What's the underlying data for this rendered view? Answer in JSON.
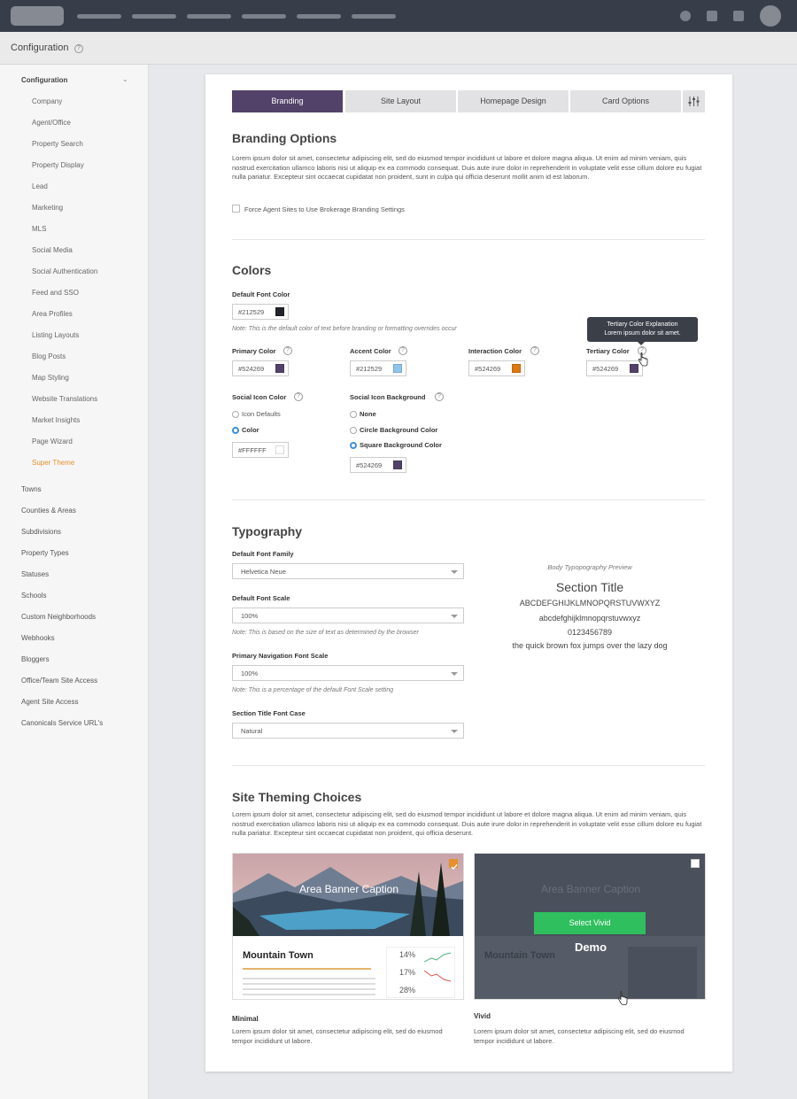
{
  "header": {
    "title": "Configuration"
  },
  "sidebar": {
    "section_title": "Configuration",
    "sub_items": [
      "Company",
      "Agent/Office",
      "Property Search",
      "Property Display",
      "Lead",
      "Marketing",
      "MLS",
      "Social Media",
      "Social Authentication",
      "Feed and SSO",
      "Area Profiles",
      "Listing Layouts",
      "Blog Posts",
      "Map Styling",
      "Website Translations",
      "Market Insights",
      "Page Wizard",
      "Super Theme"
    ],
    "active_sub_item": "Super Theme",
    "items": [
      "Towns",
      "Counties & Areas",
      "Subdivisions",
      "Property Types",
      "Statuses",
      "Schools",
      "Custom Neighborhoods",
      "Webhooks",
      "Bloggers",
      "Office/Team Site Access",
      "Agent Site Access",
      "Canonicals Service URL's"
    ]
  },
  "tabs": [
    "Branding",
    "Site Layout",
    "Homepage Design",
    "Card Options"
  ],
  "active_tab": "Branding",
  "branding": {
    "title": "Branding Options",
    "description": "Lorem ipsum dolor sit amet, consectetur adipiscing elit, sed do eiusmod tempor incididunt ut labore et dolore magna aliqua. Ut enim ad minim veniam, quis nostrud exercitation ullamco laboris nisi ut aliquip ex ea commodo consequat. Duis aute irure dolor in reprehenderit in voluptate velit esse cillum dolore eu fugiat nulla pariatur. Excepteur sint occaecat cupidatat non proident, sunt in culpa qui officia deserunt mollit anim id est laborum.",
    "checkbox_label": "Force Agent Sites to Use Brokerage Branding Settings",
    "checkbox_checked": false
  },
  "colors": {
    "title": "Colors",
    "default_font": {
      "label": "Default Font Color",
      "hex": "#212529",
      "swatch": "#212529"
    },
    "default_note": "Note: This is the default color of text before branding or formatting overrides occur",
    "primary": {
      "label": "Primary Color",
      "hex": "#524269",
      "swatch": "#524269"
    },
    "accent": {
      "label": "Accent Color",
      "hex": "#212529",
      "swatch": "#8ec5ec"
    },
    "interaction": {
      "label": "Interaction Color",
      "hex": "#524269",
      "swatch": "#e0780f"
    },
    "tertiary": {
      "label": "Tertiary Color",
      "hex": "#524269",
      "swatch": "#524269"
    },
    "tooltip": {
      "title": "Tertiary Color Explanation",
      "body": "Lorem ipsum dolor sit amet."
    },
    "social_icon": {
      "label": "Social Icon Color",
      "options": [
        "Icon Defaults",
        "Color"
      ],
      "selected": "Color",
      "hex": "#FFFFFF",
      "swatch": "#ffffff"
    },
    "social_bg": {
      "label": "Social Icon Background",
      "options": [
        "None",
        "Circle Background Color",
        "Square Background Color"
      ],
      "selected": "Square Background Color",
      "hex": "#524269",
      "swatch": "#524269"
    }
  },
  "typography": {
    "title": "Typography",
    "font_family": {
      "label": "Default Font Family",
      "value": "Helvetica Neue"
    },
    "font_scale": {
      "label": "Default Font Scale",
      "value": "100%",
      "note": "Note: This is based on the size of text as determined by the browser"
    },
    "nav_scale": {
      "label": "Primary Navigation Font Scale",
      "value": "100%",
      "note": "Note: This is a percentage of the default Font Scale setting"
    },
    "title_case": {
      "label": "Section Title Font Case",
      "value": "Natural"
    },
    "preview": {
      "caption": "Body Typopography Preview",
      "heading": "Section Title",
      "upper": "ABCDEFGHIJKLMNOPQRSTUVWXYZ",
      "lower": "abcdefghijklmnopqrstuvwxyz",
      "digits": "0123456789",
      "pangram": "the quick brown fox jumps over the lazy dog"
    }
  },
  "theming": {
    "title": "Site Theming Choices",
    "description": "Lorem ipsum dolor sit amet, consectetur adipiscing elit, sed do eiusmod tempor incididunt ut labore et dolore magna aliqua. Ut enim ad minim veniam, quis nostrud exercitation ullamco laboris nisi ut aliquip ex ea commodo consequat. Duis aute irure dolor in reprehenderit in voluptate velit esse cillum dolore eu fugiat nulla pariatur. Excepteur sint occaecat cupidatat non proident, qui officia deserunt.",
    "minimal": {
      "caption": "Area Banner Caption",
      "town": "Mountain Town",
      "stats": [
        "14%",
        "17%",
        "28%"
      ],
      "name": "Minimal",
      "description": "Lorem ipsum dolor sit amet, consectetur adipiscing elit, sed do eiusmod tempor incididunt ut labore.",
      "checked": true
    },
    "vivid": {
      "caption": "Area Banner Caption",
      "button": "Select Vivid",
      "demo": "Demo",
      "town": "Mountain Town",
      "name": "Vivid",
      "description": "Lorem ipsum dolor sit amet, consectetur adipiscing elit, sed do eiusmod tempor incididunt ut labore.",
      "checked": false
    }
  }
}
